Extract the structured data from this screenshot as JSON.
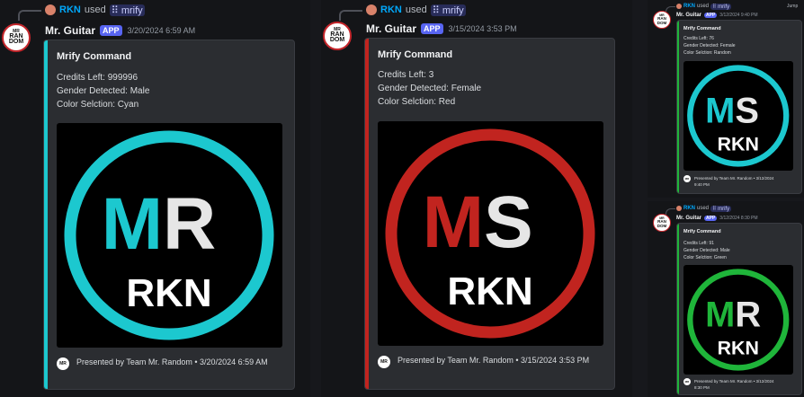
{
  "colors": {
    "cyan": "#1cc8cf",
    "red": "#c1241f",
    "green": "#1fb53a",
    "brand": "#5865f2",
    "username_blue": "#00a8fc"
  },
  "avatar_text": {
    "line1": "MR",
    "line2": "RAN",
    "line3": "DOM"
  },
  "footer_icon_text": "MR",
  "messages": [
    {
      "reply": {
        "user": "RKN",
        "used": "used",
        "command": "mrify",
        "command_icon": "slash-command-icon"
      },
      "author": "Mr. Guitar",
      "badge": "APP",
      "timestamp": "3/20/2024 6:59 AM",
      "embed": {
        "title": "Mrify Command",
        "credits": "Credits Left: 999996",
        "gender": "Gender Detected: Male",
        "color": "Color Selction: Cyan",
        "logo_left": "M",
        "logo_right": "R",
        "logo_bottom": "RKN",
        "footer": "Presented by Team Mr. Random • 3/20/2024 6:59 AM"
      }
    },
    {
      "reply": {
        "user": "RKN",
        "used": "used",
        "command": "mrify",
        "command_icon": "slash-command-icon"
      },
      "author": "Mr. Guitar",
      "badge": "APP",
      "timestamp": "3/15/2024 3:53 PM",
      "embed": {
        "title": "Mrify Command",
        "credits": "Credits Left: 3",
        "gender": "Gender Detected: Female",
        "color": "Color Selction: Red",
        "logo_left": "M",
        "logo_right": "S",
        "logo_bottom": "RKN",
        "footer": "Presented by Team Mr. Random • 3/15/2024 3:53 PM"
      }
    },
    {
      "reply": {
        "user": "RKN",
        "used": "used",
        "command": "mrify",
        "command_icon": "slash-command-icon"
      },
      "author": "Mr. Guitar",
      "badge": "APP",
      "timestamp": "3/12/2024 9:40 PM",
      "embed": {
        "title": "Mrify Command",
        "credits": "Credits Left: 76",
        "gender": "Gender Detected: Female",
        "color": "Color Selction: Random",
        "logo_left": "M",
        "logo_right": "S",
        "logo_bottom": "RKN",
        "footer_line1": "Presented by Team Mr. Random • 3/12/2024",
        "footer_line2": "9:40 PM"
      }
    },
    {
      "reply": {
        "user": "RKN",
        "used": "used",
        "command": "mrify",
        "command_icon": "slash-command-icon"
      },
      "author": "Mr. Guitar",
      "badge": "APP",
      "timestamp": "3/12/2024 8:30 PM",
      "embed": {
        "title": "Mrify Command",
        "credits": "Credits Left: 91",
        "gender": "Gender Detected: Male",
        "color": "Color Selction: Green",
        "logo_left": "M",
        "logo_right": "R",
        "logo_bottom": "RKN",
        "footer_line1": "Presented by Team Mr. Random • 3/12/2024",
        "footer_line2": "8:30 PM"
      }
    }
  ],
  "jump_label": "Jump"
}
